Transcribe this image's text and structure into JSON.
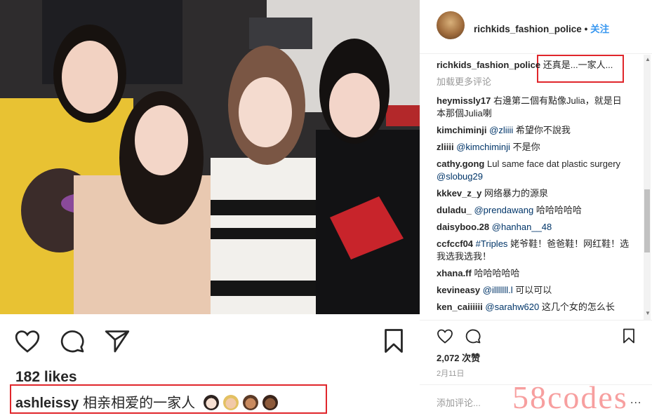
{
  "post": {
    "likes": "182 likes",
    "caption_user": "ashleissy",
    "caption_text": "相亲相爱的一家人",
    "caption_emojis": [
      "woman-icon",
      "woman-icon",
      "woman-icon",
      "woman-icon"
    ]
  },
  "sidebar": {
    "username": "richkids_fashion_police",
    "separator": "•",
    "follow": "关注",
    "load_more": "加载更多评论",
    "likes": "2,072 次赞",
    "date": "2月11日",
    "add_comment_placeholder": "添加评论...",
    "more": "..."
  },
  "comments": [
    {
      "user": "richkids_fashion_police",
      "text": "还真是...一家人..."
    },
    {
      "user": "heymissly17",
      "text": "右邊第二個有點像Julia，就是日本那個Julia喇"
    },
    {
      "user": "kimchiminji",
      "mention": "@zliiii",
      "text": "希望你不說我"
    },
    {
      "user": "zliiii",
      "mention": "@kimchiminji",
      "text": "不是你"
    },
    {
      "user": "cathy.gong",
      "text": "Lul same face dat plastic surgery",
      "mention_after": "@slobug29"
    },
    {
      "user": "kkkev_z_y",
      "text": "网络暴力的源泉"
    },
    {
      "user": "duladu_",
      "mention": "@prendawang",
      "text": "哈哈哈哈哈"
    },
    {
      "user": "daisyboo.28",
      "mention": "@hanhan__48",
      "text": ""
    },
    {
      "user": "ccfccf04",
      "mention": "#Triples",
      "text": "姥爷鞋！爸爸鞋！网红鞋！选我选我选我！"
    },
    {
      "user": "xhana.ff",
      "text": "哈哈哈哈哈"
    },
    {
      "user": "kevineasy",
      "mention": "@illlllll.l",
      "text": "可以可以"
    },
    {
      "user": "ken_caiiiiii",
      "mention": "@sarahw620",
      "text": "这几个女的怎么长"
    }
  ],
  "watermark": "58codes",
  "colors": {
    "highlight": "#e0262b",
    "link": "#3897f0",
    "mention": "#003569"
  }
}
